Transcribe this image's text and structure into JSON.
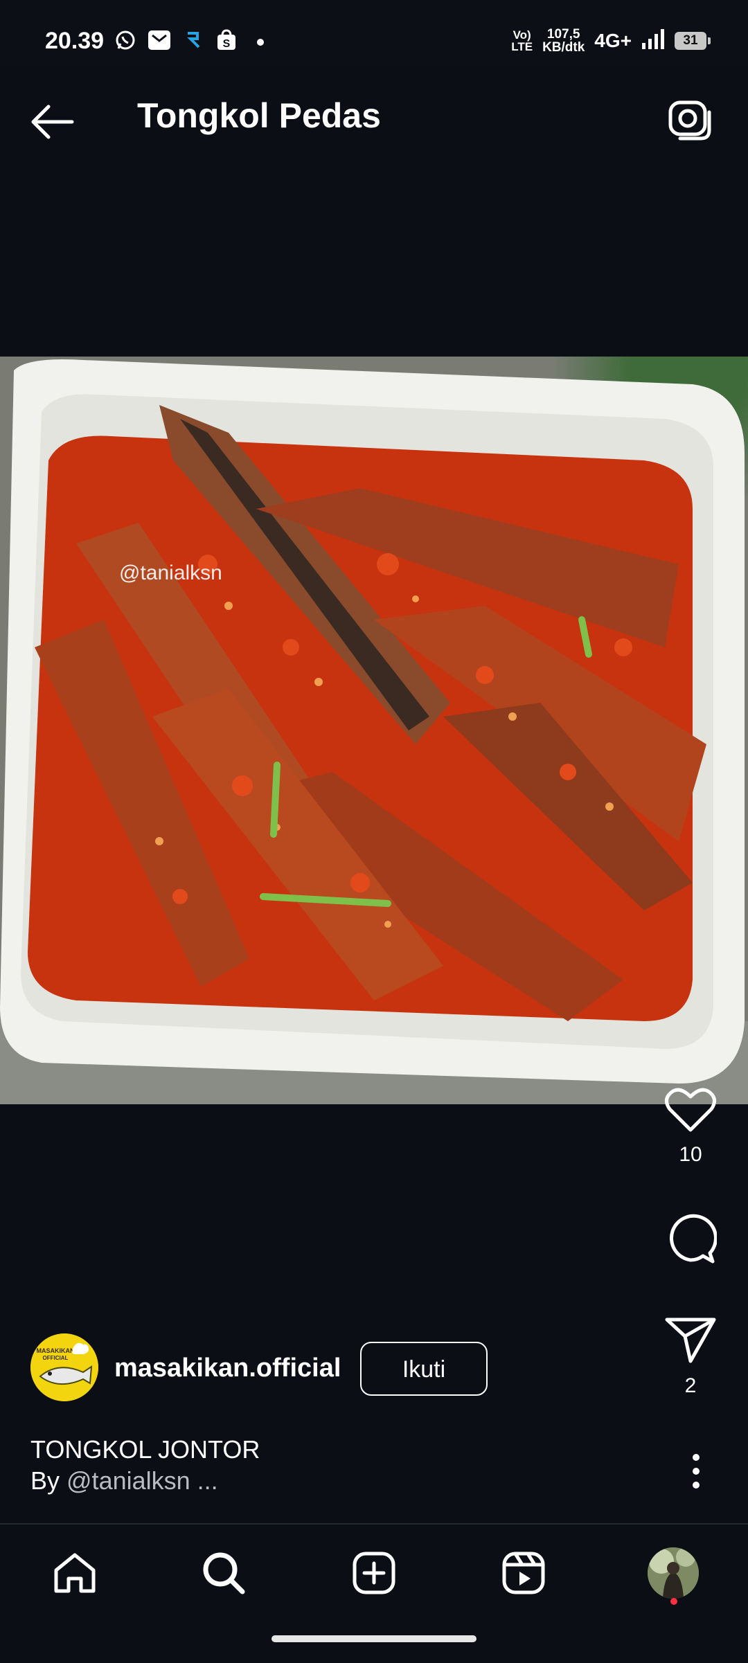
{
  "status_bar": {
    "time": "20.39",
    "net_type_line1": "Vo)",
    "net_type_line2": "LTE",
    "speed_line1": "107,5",
    "speed_line2": "KB/dtk",
    "network": "4G+",
    "battery": "31",
    "icons": [
      "whatsapp-icon",
      "mail-icon",
      "app-icon",
      "shop-icon",
      "dot-icon",
      "signal-icon"
    ]
  },
  "header": {
    "title": "Tongkol Pedas",
    "back_icon": "arrow-left-icon",
    "camera_icon": "camera-icon"
  },
  "post": {
    "photo_watermark": "@tanialksn",
    "likes": "10",
    "shares": "2",
    "author": "masakikan.official",
    "avatar_text": "MASAKIKAN OFFICIAL",
    "follow_label": "Ikuti",
    "caption_title": "TONGKOL JONTOR",
    "caption_by_prefix": "By ",
    "caption_mention": "@tanialksn",
    "caption_more": " ..."
  },
  "bottom_nav": {
    "items": [
      "home-icon",
      "search-icon",
      "add-post-icon",
      "reels-icon",
      "profile-avatar"
    ]
  },
  "colors": {
    "background": "#0b0f15",
    "text": "#ffffff",
    "notification": "#ff3040"
  }
}
